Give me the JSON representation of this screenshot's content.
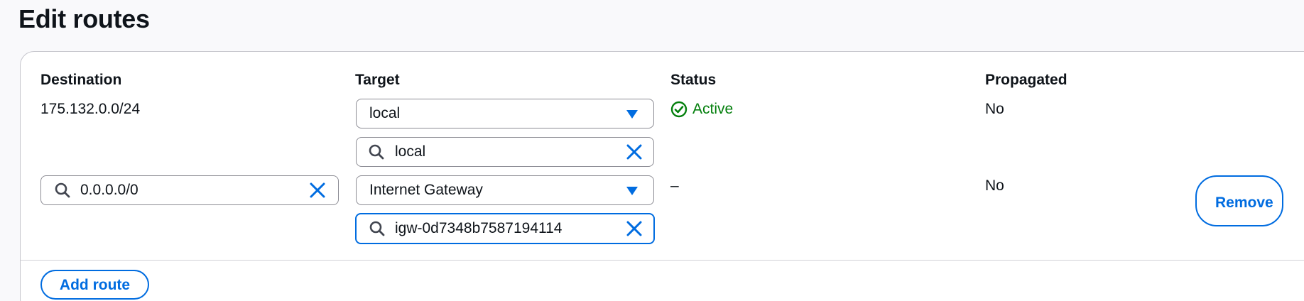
{
  "page_title": "Edit routes",
  "columns": {
    "destination": "Destination",
    "target": "Target",
    "status": "Status",
    "propagated": "Propagated"
  },
  "routes": [
    {
      "destination": "175.132.0.0/24",
      "target_type": "local",
      "target_value": "local",
      "status": "Active",
      "propagated": "No"
    },
    {
      "destination": "0.0.0.0/0",
      "target_type": "Internet Gateway",
      "target_value": "igw-0d7348b7587194114",
      "status": "–",
      "propagated": "No",
      "remove_label": "Remove"
    }
  ],
  "actions": {
    "add_route": "Add route"
  },
  "colors": {
    "accent": "#006ce0",
    "success": "#037f0c",
    "text": "#0f141a",
    "border": "#8c8c94"
  },
  "icons": {
    "search": "search-icon",
    "clear": "close-icon",
    "dropdown": "caret-down-icon",
    "status_ok": "check-circle-icon"
  }
}
